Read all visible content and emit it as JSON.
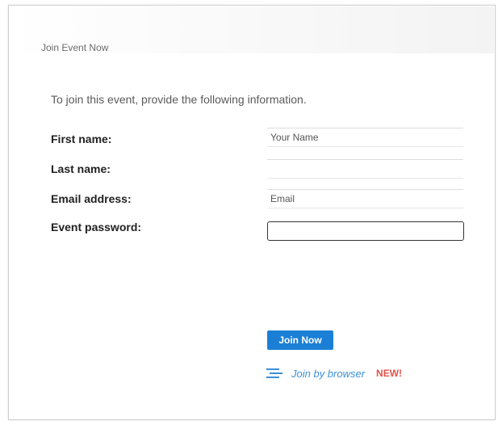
{
  "window": {
    "title": "Join Event Now"
  },
  "form": {
    "instruction": "To join this event, provide the following information.",
    "fields": [
      {
        "label": "First name:",
        "value": "Your Name",
        "placeholder": ""
      },
      {
        "label": "Last name:",
        "value": "",
        "placeholder": ""
      },
      {
        "label": "Email address:",
        "value": "Email",
        "placeholder": ""
      },
      {
        "label": "Event password:",
        "value": "",
        "placeholder": ""
      }
    ]
  },
  "actions": {
    "join_label": "Join Now",
    "browser_link_label": "Join by browser",
    "browser_link_icon": "browser-join-icon",
    "new_badge": "NEW!"
  },
  "colors": {
    "accent": "#1b7fd6",
    "link": "#3c8fd8",
    "badge": "#e2554b"
  }
}
